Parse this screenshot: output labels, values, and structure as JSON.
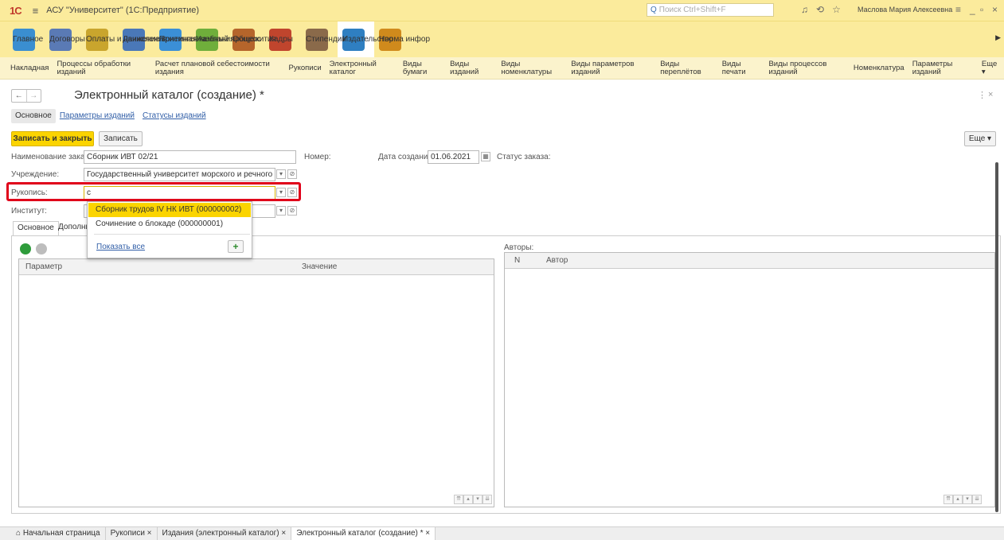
{
  "titlebar": {
    "logo": "1С",
    "app_title": "АСУ \"Университет\" (1С:Предприятие)",
    "search_placeholder": "Поиск Ctrl+Shift+F",
    "user": "Маслова Мария Алексеевна"
  },
  "sections": [
    {
      "label": "Главное",
      "color": "#3a8ed0"
    },
    {
      "label": "Договоры",
      "color": "#5a7ab5"
    },
    {
      "label": "Оплаты и начисления",
      "color": "#c9a52d"
    },
    {
      "label": "Движение контингента",
      "color": "#4a78b8"
    },
    {
      "label": "Приемная кампания",
      "color": "#3b8fd6"
    },
    {
      "label": "Учебный процесс",
      "color": "#6fae3b"
    },
    {
      "label": "Общежития",
      "color": "#b5652b"
    },
    {
      "label": "Кадры",
      "color": "#c0452d"
    },
    {
      "label": "Стипендии",
      "color": "#8a6a4a"
    },
    {
      "label": "Издательство",
      "color": "#2f7fc1"
    },
    {
      "label": "Норма инфор",
      "color": "#d08a1c"
    }
  ],
  "nav_items": [
    "Накладная",
    "Процессы обработки изданий",
    "Расчет плановой себестоимости издания",
    "Рукописи",
    "Электронный каталог",
    "Виды бумаги",
    "Виды изданий",
    "Виды номенклатуры",
    "Виды параметров изданий",
    "Виды переплётов",
    "Виды печати",
    "Виды процессов изданий",
    "Номенклатура",
    "Параметры изданий",
    "Еще ▾"
  ],
  "form": {
    "title": "Электронный каталог (создание) *",
    "tabs": [
      "Основное",
      "Параметры изданий",
      "Статусы изданий"
    ],
    "save_close": "Записать и закрыть",
    "save": "Записать",
    "more": "Еще ▾",
    "order_name_label": "Наименование заказа:",
    "order_name_value": "Сборник ИВТ 02/21",
    "number_label": "Номер:",
    "date_label": "Дата создания:",
    "date_value": "01.06.2021",
    "status_label": "Статус заказа:",
    "institution_label": "Учреждение:",
    "institution_value": "Государственный университет морского и речного флота им",
    "manuscript_label": "Рукопись:",
    "manuscript_value": "с",
    "institute_label": "Институт:",
    "inner_tabs": [
      "Основное",
      "Дополни"
    ],
    "params_col": "Параметр",
    "value_col": "Значение",
    "authors_label": "Авторы:",
    "authors_n": "N",
    "authors_col": "Автор"
  },
  "dropdown": {
    "items": [
      "Сборник трудов IV НК ИВТ (000000002)",
      "Сочинение о блокаде (000000001)"
    ],
    "show_all": "Показать все",
    "add": "+"
  },
  "bottom_tabs": [
    "Начальная страница",
    "Рукописи ×",
    "Издания (электронный каталог) ×",
    "Электронный каталог (создание) * ×"
  ]
}
